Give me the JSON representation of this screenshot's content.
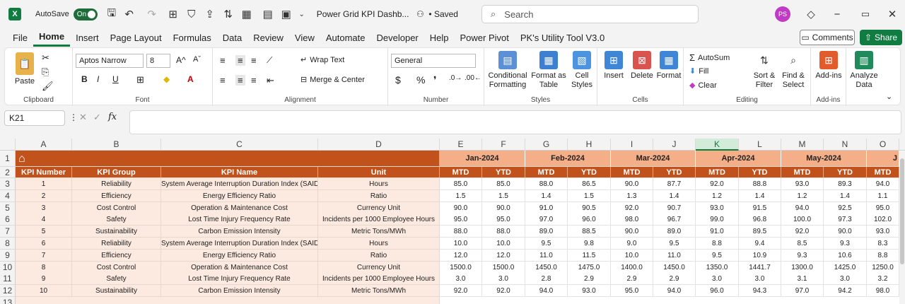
{
  "titlebar": {
    "app_logo": "X",
    "autosave_label": "AutoSave",
    "autosave_state": "On",
    "doc_title": "Power Grid KPI Dashb...",
    "save_status": "• Saved",
    "search_placeholder": "Search",
    "avatar_initials": "PS"
  },
  "menu": {
    "items": [
      "File",
      "Home",
      "Insert",
      "Page Layout",
      "Formulas",
      "Data",
      "Review",
      "View",
      "Automate",
      "Developer",
      "Help",
      "Power Pivot",
      "PK's Utility Tool V3.0"
    ],
    "active": "Home",
    "comments_label": "Comments",
    "share_label": "Share"
  },
  "ribbon": {
    "clipboard": {
      "paste": "Paste",
      "label": "Clipboard"
    },
    "font": {
      "name": "Aptos Narrow",
      "size": "8",
      "label": "Font",
      "bold": "B",
      "italic": "I",
      "underline": "U"
    },
    "alignment": {
      "wrap": "Wrap Text",
      "merge": "Merge & Center",
      "label": "Alignment"
    },
    "number": {
      "format": "General",
      "label": "Number",
      "currency": "$",
      "percent": "%",
      "comma": "❜"
    },
    "styles": {
      "cond": "Conditional",
      "cond2": "Formatting",
      "fmt_table": "Format as",
      "fmt_table2": "Table",
      "cell": "Cell",
      "cell2": "Styles",
      "label": "Styles"
    },
    "cells": {
      "insert": "Insert",
      "delete": "Delete",
      "format": "Format",
      "label": "Cells"
    },
    "editing": {
      "autosum": "AutoSum",
      "fill": "Fill",
      "clear": "Clear",
      "sort": "Sort &",
      "sort2": "Filter",
      "find": "Find &",
      "find2": "Select",
      "label": "Editing"
    },
    "addins": {
      "addins": "Add-ins",
      "label": "Add-ins"
    },
    "analyze": {
      "l1": "Analyze",
      "l2": "Data"
    }
  },
  "formula_bar": {
    "name_box": "K21",
    "fx": "fx",
    "value": ""
  },
  "grid": {
    "columns": [
      "A",
      "B",
      "C",
      "D",
      "E",
      "F",
      "G",
      "H",
      "I",
      "J",
      "K",
      "L",
      "M",
      "N",
      "O"
    ],
    "selected_column": "K",
    "rows": [
      "1",
      "2",
      "3",
      "4",
      "5",
      "6",
      "7",
      "8",
      "9",
      "10",
      "11",
      "12",
      "13"
    ],
    "months": [
      "Jan-2024",
      "Feb-2024",
      "Mar-2024",
      "Apr-2024",
      "May-2024",
      "J"
    ],
    "headers": {
      "kpi_number": "KPI Number",
      "kpi_group": "KPI Group",
      "kpi_name": "KPI Name",
      "unit": "Unit",
      "mtd": "MTD",
      "ytd": "YTD"
    },
    "kpis": [
      {
        "num": "1",
        "group": "Reliability",
        "name": "System Average Interruption Duration Index (SAIDI)",
        "unit": "Hours",
        "vals": [
          "85.0",
          "85.0",
          "88.0",
          "86.5",
          "90.0",
          "87.7",
          "92.0",
          "88.8",
          "93.0",
          "89.3",
          "94.0"
        ]
      },
      {
        "num": "2",
        "group": "Efficiency",
        "name": "Energy Efficiency Ratio",
        "unit": "Ratio",
        "vals": [
          "1.5",
          "1.5",
          "1.4",
          "1.5",
          "1.3",
          "1.4",
          "1.2",
          "1.4",
          "1.2",
          "1.4",
          "1.1"
        ]
      },
      {
        "num": "3",
        "group": "Cost Control",
        "name": "Operation & Maintenance Cost",
        "unit": "Currency Unit",
        "vals": [
          "90.0",
          "90.0",
          "91.0",
          "90.5",
          "92.0",
          "90.7",
          "93.0",
          "91.5",
          "94.0",
          "92.5",
          "95.0"
        ]
      },
      {
        "num": "4",
        "group": "Safety",
        "name": "Lost Time Injury Frequency Rate",
        "unit": "Incidents per 1000 Employee Hours",
        "vals": [
          "95.0",
          "95.0",
          "97.0",
          "96.0",
          "98.0",
          "96.7",
          "99.0",
          "96.8",
          "100.0",
          "97.3",
          "102.0"
        ]
      },
      {
        "num": "5",
        "group": "Sustainability",
        "name": "Carbon Emission Intensity",
        "unit": "Metric Tons/MWh",
        "vals": [
          "88.0",
          "88.0",
          "89.0",
          "88.5",
          "90.0",
          "89.0",
          "91.0",
          "89.5",
          "92.0",
          "90.0",
          "93.0"
        ]
      },
      {
        "num": "6",
        "group": "Reliability",
        "name": "System Average Interruption Duration Index (SAIDI)",
        "unit": "Hours",
        "vals": [
          "10.0",
          "10.0",
          "9.5",
          "9.8",
          "9.0",
          "9.5",
          "8.8",
          "9.4",
          "8.5",
          "9.3",
          "8.3"
        ]
      },
      {
        "num": "7",
        "group": "Efficiency",
        "name": "Energy Efficiency Ratio",
        "unit": "Ratio",
        "vals": [
          "12.0",
          "12.0",
          "11.0",
          "11.5",
          "10.0",
          "11.0",
          "9.5",
          "10.9",
          "9.3",
          "10.6",
          "8.8"
        ]
      },
      {
        "num": "8",
        "group": "Cost Control",
        "name": "Operation & Maintenance Cost",
        "unit": "Currency Unit",
        "vals": [
          "1500.0",
          "1500.0",
          "1450.0",
          "1475.0",
          "1400.0",
          "1450.0",
          "1350.0",
          "1441.7",
          "1300.0",
          "1425.0",
          "1250.0"
        ]
      },
      {
        "num": "9",
        "group": "Safety",
        "name": "Lost Time Injury Frequency Rate",
        "unit": "Incidents per 1000 Employee Hours",
        "vals": [
          "3.0",
          "3.0",
          "2.8",
          "2.9",
          "2.9",
          "2.9",
          "3.0",
          "3.0",
          "3.1",
          "3.0",
          "3.2"
        ]
      },
      {
        "num": "10",
        "group": "Sustainability",
        "name": "Carbon Emission Intensity",
        "unit": "Metric Tons/MWh",
        "vals": [
          "92.0",
          "92.0",
          "94.0",
          "93.0",
          "95.0",
          "94.0",
          "96.0",
          "94.3",
          "97.0",
          "94.2",
          "98.0"
        ]
      }
    ]
  },
  "colors": {
    "header_dark": "#c2521c",
    "header_light": "#f4ae88",
    "row_pink": "#fce9df",
    "brand": "#107c41"
  }
}
